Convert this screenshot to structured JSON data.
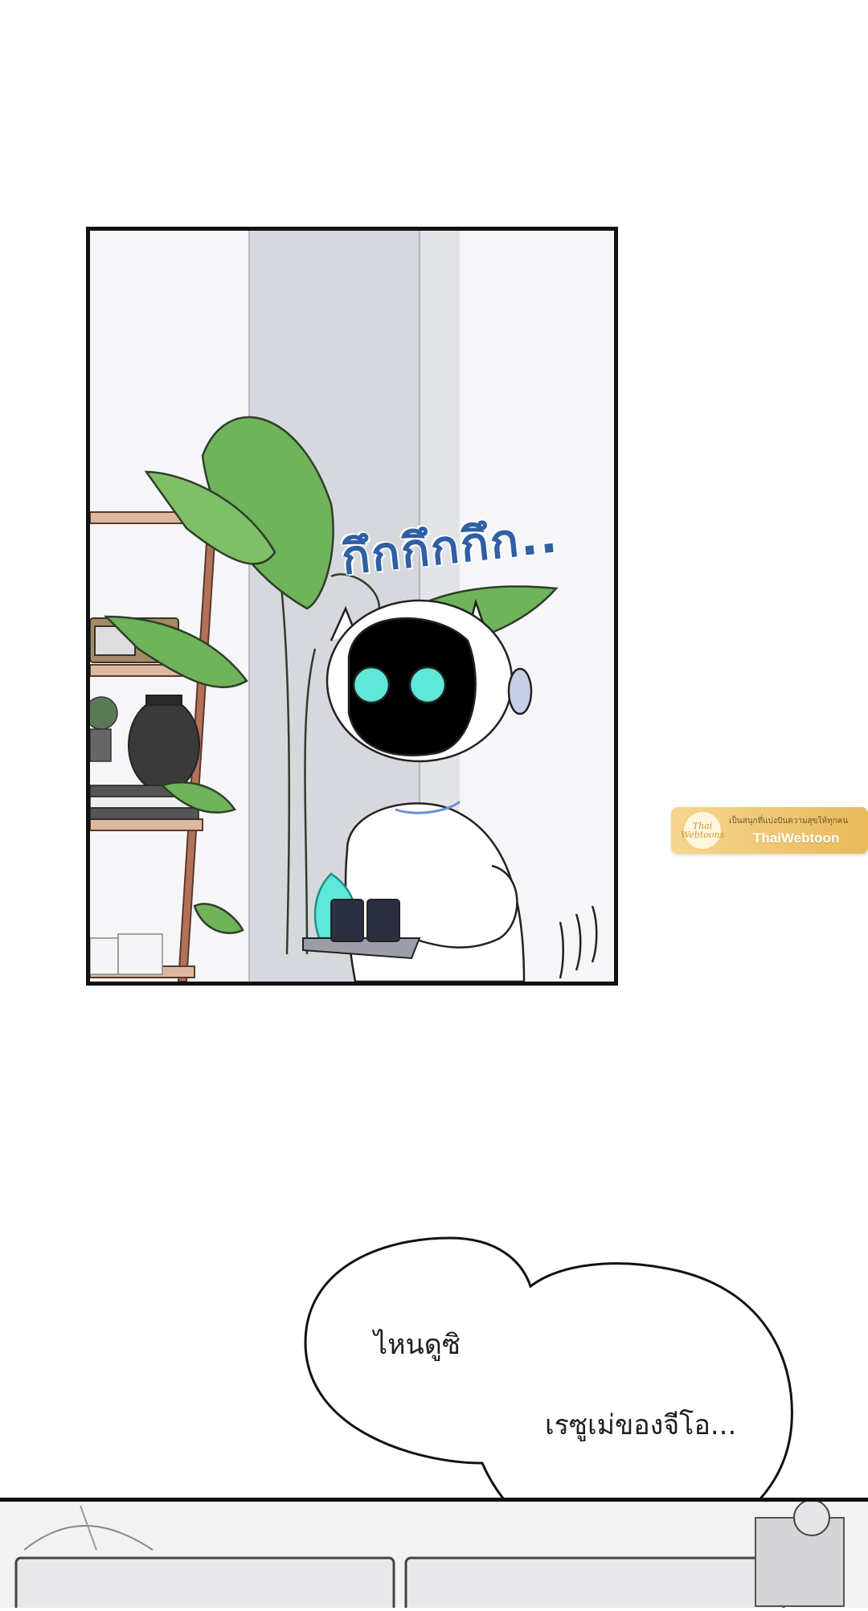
{
  "panel_top": {
    "sfx_text": "กึกกึกกึก.."
  },
  "watermark": {
    "logo_text": "Thai Webtoons",
    "tagline": "เป็นสนุกที่แบ่งปันความสุขให้ทุกคน",
    "brand": "ThaiWebtoon"
  },
  "speech_bubble": {
    "line1": "ไหนดูซิ",
    "line2": "เรซูเม่ของจีโอ..."
  },
  "colors": {
    "sfx": "#2f5fa5",
    "robot_eye": "#5ee8d8",
    "plant": "#6fb35a",
    "watermark_gold": "#e9b95a"
  }
}
